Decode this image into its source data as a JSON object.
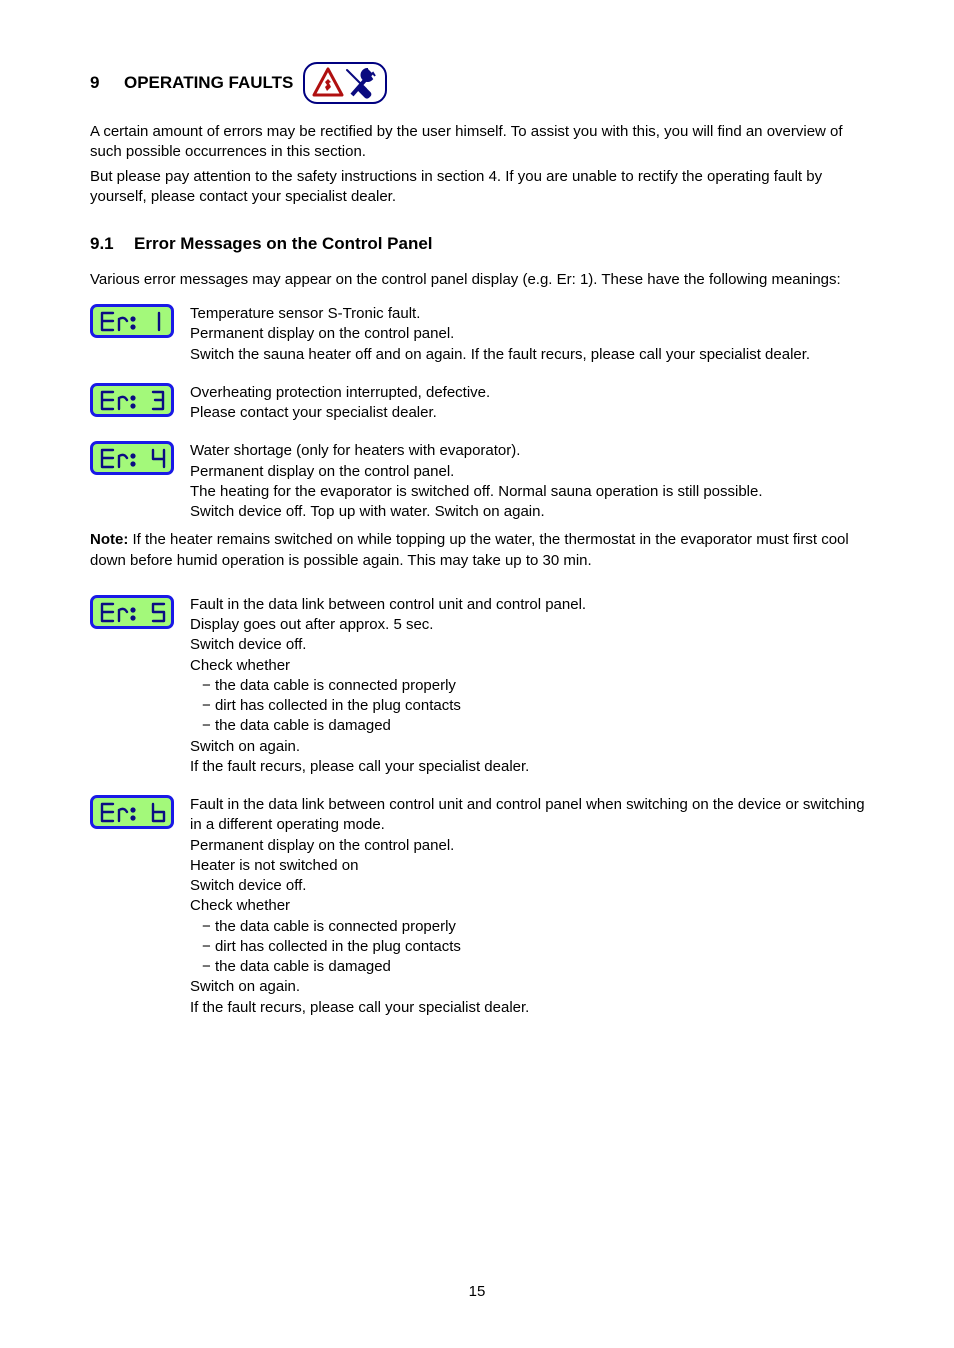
{
  "heading": {
    "number": "9",
    "title": "OPERATING FAULTS"
  },
  "intro": {
    "p1": "A certain amount of errors may be rectified by the user himself. To assist you with this, you will find an overview of such possible occurrences in this section.",
    "p2": "But please pay attention to the safety instructions in section 4. If you are unable to rectify the operating fault by yourself, please contact your specialist dealer."
  },
  "subheading": {
    "number": "9.1",
    "title": "Error Messages on the Control Panel"
  },
  "sub_intro": "Various error messages may appear on the control panel display (e.g. Er: 1). These have the following meanings:",
  "errors": [
    {
      "code": "Er: 1",
      "lines": [
        "Temperature sensor S-Tronic fault.",
        "Permanent display on the control panel.",
        "Switch the sauna heater off and on again. If the fault recurs, please call your specialist dealer."
      ]
    },
    {
      "code": "Er: 3",
      "lines": [
        "Overheating protection interrupted, defective.",
        "Please contact your specialist dealer."
      ]
    },
    {
      "code": "Er: 4",
      "lines": [
        "Water shortage (only for heaters with evaporator).",
        "Permanent display on the control panel.",
        "The heating for the evaporator is switched off. Normal sauna operation is still possible.",
        "Switch device off. Top up with water. Switch on again."
      ],
      "note": "If the heater remains switched on while topping up the water, the thermostat in the evaporator must first cool down before humid operation is possible again. This may take up to 30 min."
    },
    {
      "code": "Er: 5",
      "lines": [
        "Fault in the data link between control unit and control panel.",
        "Display goes out after approx. 5 sec.",
        "Switch device off."
      ],
      "checks_label": "Check whether",
      "checks": [
        "the data cable is connected properly",
        "dirt has collected in the plug contacts",
        "the data cable is damaged"
      ],
      "after": [
        "Switch on again.",
        "If the fault recurs, please call your specialist dealer."
      ]
    },
    {
      "code": "Er: 6",
      "lines": [
        "Fault in the data link between control unit and control panel when switching on the device or switching in a different operating mode.",
        "Permanent display on the control panel.",
        "Heater is not switched on",
        "Switch device off."
      ],
      "checks_label": "Check whether",
      "checks": [
        "the data cable is connected properly",
        "dirt has collected in the plug contacts",
        "the data cable is damaged"
      ],
      "after": [
        "Switch on again.",
        "If the fault recurs, please call your specialist dealer."
      ]
    }
  ],
  "note_label": "Note:",
  "page_number": "15"
}
